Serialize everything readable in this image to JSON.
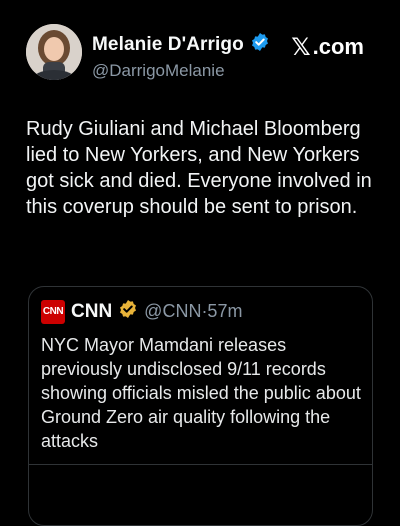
{
  "author": {
    "display_name": "Melanie D'Arrigo",
    "handle": "@DarrigoMelanie",
    "verified_color": "#1d9bf0"
  },
  "brand": {
    "label": ".com",
    "icon": "x-logo-icon"
  },
  "tweet": {
    "text": "Rudy Giuliani and Michael Bloomberg lied to New Yorkers, and New Yorkers got sick and died. Everyone involved in this coverup should be sent to prison."
  },
  "quote": {
    "logo_text": "CNN",
    "name": "CNN",
    "verified_color": "#e8b339",
    "handle_time": "@CNN·57m",
    "text": "NYC Mayor Mamdani releases previously undisclosed 9/11 records showing officials misled the public about Ground Zero air quality following the attacks"
  }
}
